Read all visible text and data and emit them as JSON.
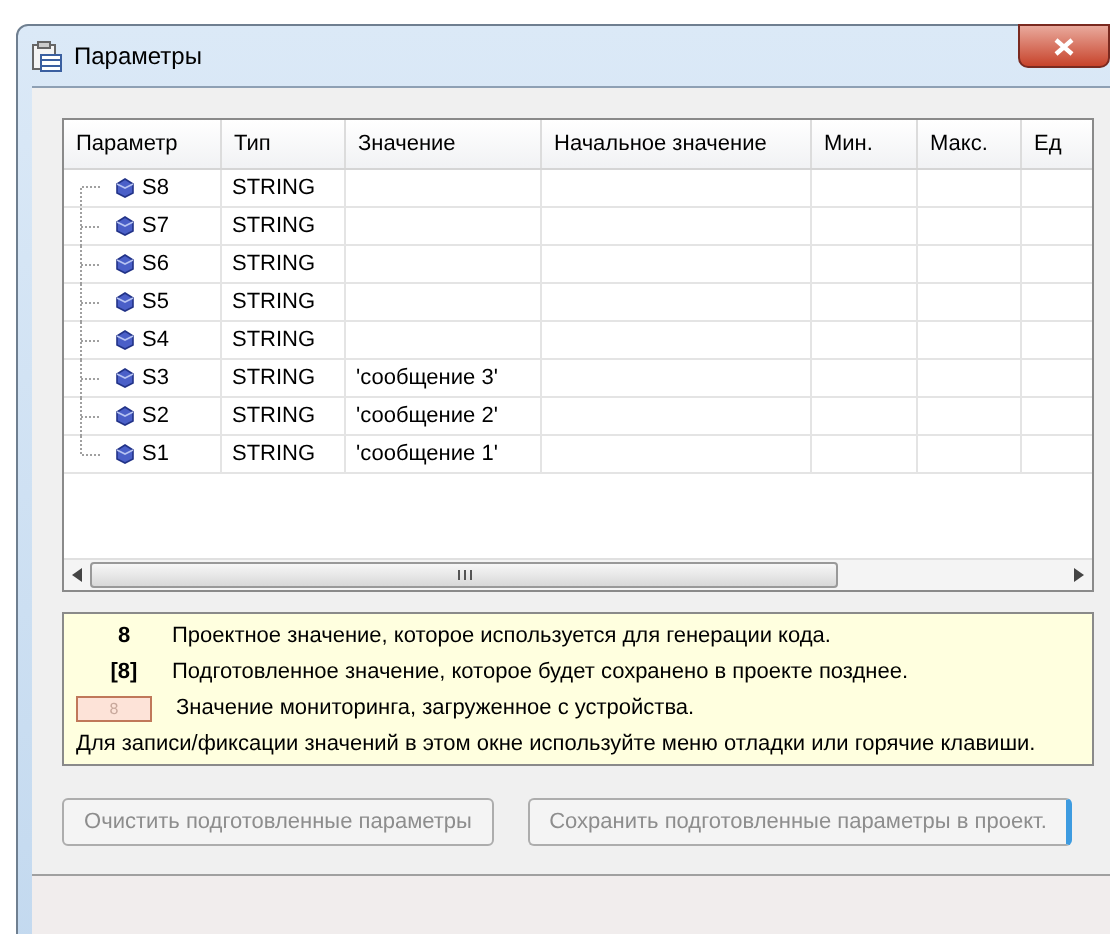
{
  "window": {
    "title": "Параметры"
  },
  "table": {
    "columns": [
      "Параметр",
      "Тип",
      "Значение",
      "Начальное значение",
      "Мин.",
      "Макс.",
      "Ед"
    ],
    "rows": [
      {
        "name": "S8",
        "type": "STRING",
        "value": ""
      },
      {
        "name": "S7",
        "type": "STRING",
        "value": ""
      },
      {
        "name": "S6",
        "type": "STRING",
        "value": ""
      },
      {
        "name": "S5",
        "type": "STRING",
        "value": ""
      },
      {
        "name": "S4",
        "type": "STRING",
        "value": ""
      },
      {
        "name": "S3",
        "type": "STRING",
        "value": "'сообщение 3'"
      },
      {
        "name": "S2",
        "type": "STRING",
        "value": "'сообщение 2'"
      },
      {
        "name": "S1",
        "type": "STRING",
        "value": "'сообщение 1'"
      }
    ]
  },
  "legend": {
    "items": [
      {
        "kind": "plain",
        "sample": "8",
        "text": "Проектное значение, которое используется для генерации кода."
      },
      {
        "kind": "bracket",
        "sample": "[8]",
        "text": "Подготовленное значение, которое будет сохранено в проекте позднее."
      },
      {
        "kind": "boxed",
        "sample": "8",
        "text": "Значение мониторинга, загруженное с устройства."
      }
    ],
    "note": "Для записи/фиксации значений в этом окне используйте меню отладки или горячие клавиши."
  },
  "buttons": [
    {
      "label": "Очистить подготовленные параметры",
      "disabled": true
    },
    {
      "label": "Сохранить подготовленные параметры в проект.",
      "disabled": true
    }
  ]
}
